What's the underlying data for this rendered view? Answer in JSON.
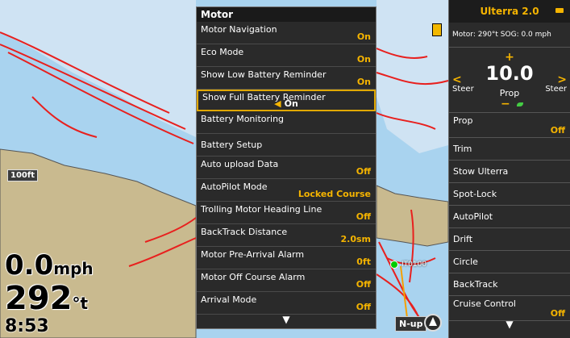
{
  "map": {
    "depth_marker": "100ft",
    "waypoint_label": "IT0100",
    "orientation": "N-up",
    "speed_value": "0.0",
    "speed_unit": "mph",
    "heading_value": "292",
    "heading_unit": "°t",
    "clock": "8:53",
    "colors": {
      "water": "#a9d3ef",
      "channel": "#cfe3f3",
      "land": "#c9ba8f",
      "track": "#e8201e"
    }
  },
  "menu": {
    "title": "Motor",
    "items": [
      {
        "label": "Motor Navigation",
        "value": "On"
      },
      {
        "label": "Eco Mode",
        "value": "On"
      },
      {
        "label": "Show Low Battery Reminder",
        "value": "On"
      },
      {
        "label": "Show Full Battery Reminder",
        "value": "On",
        "selected": true
      },
      {
        "label": "Battery Monitoring",
        "value": ""
      },
      {
        "label": "Battery Setup",
        "value": ""
      },
      {
        "label": "Auto upload Data",
        "value": "Off"
      },
      {
        "label": "AutoPilot Mode",
        "value": "Locked Course"
      },
      {
        "label": "Trolling Motor Heading Line",
        "value": "Off"
      },
      {
        "label": "BackTrack Distance",
        "value": "2.0sm"
      },
      {
        "label": "Motor Pre-Arrival Alarm",
        "value": "0ft"
      },
      {
        "label": "Motor Off Course Alarm",
        "value": "Off"
      },
      {
        "label": "Arrival Mode",
        "value": "Off"
      }
    ],
    "scroll_icon": "chevron-down-icon"
  },
  "panel": {
    "title": "Ulterra 2.0",
    "status": "Motor:   290°t  SOG: 0.0 mph",
    "prop": {
      "value": "10.0",
      "label": "Prop",
      "plus": "+",
      "minus": "−",
      "steer_left": "Steer",
      "steer_right": "Steer",
      "left_arrow": "<",
      "right_arrow": ">"
    },
    "items": [
      {
        "label": "Prop",
        "value": "Off"
      },
      {
        "label": "Trim",
        "value": ""
      },
      {
        "label": "Stow Ulterra",
        "value": ""
      },
      {
        "label": "Spot-Lock",
        "value": ""
      },
      {
        "label": "AutoPilot",
        "value": ""
      },
      {
        "label": "Drift",
        "value": ""
      },
      {
        "label": "Circle",
        "value": ""
      },
      {
        "label": "BackTrack",
        "value": ""
      },
      {
        "label": "Cruise Control",
        "value": "Off"
      }
    ],
    "accent": "#f5b400"
  }
}
